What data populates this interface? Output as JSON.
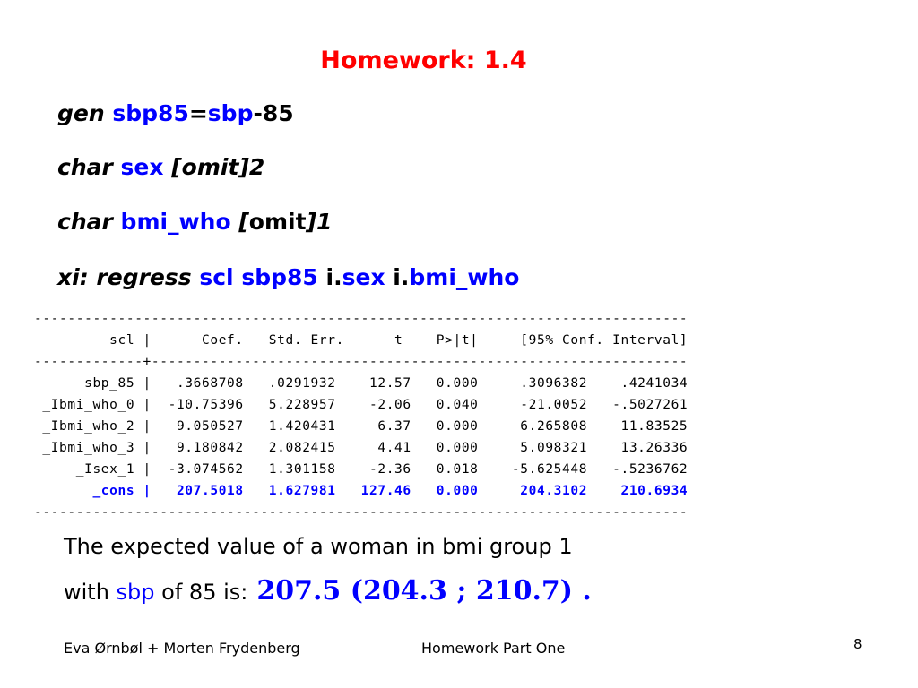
{
  "title": "Homework: 1.4",
  "commands": [
    {
      "kw": "gen",
      "var1": "sbp85",
      "eq": "=",
      "var2": "sbp",
      "rest": "-85"
    },
    {
      "kw": "char",
      "var": "sex",
      "rest": "[omit]2"
    },
    {
      "kw": "char",
      "var": "bmi_who",
      "open": "[",
      "mid": "omit",
      "close": "]1"
    },
    {
      "kw": "xi: regress",
      "v1": "scl",
      "v2": "sbp85",
      "p1": "i.",
      "v3": "sex",
      "p2": "i.",
      "v4": "bmi_who"
    }
  ],
  "output": {
    "rule_line": "------------------------------------------------------------------------------",
    "header_line": "         scl |      Coef.   Std. Err.      t    P>|t|     [95% Conf. Interval]",
    "separator_line": "-------------+----------------------------------------------------------------",
    "rows": [
      "      sbp_85 |   .3668708   .0291932    12.57   0.000     .3096382    .4241034",
      " _Ibmi_who_0 |  -10.75396   5.228957    -2.06   0.040     -21.0052   -.5027261",
      " _Ibmi_who_2 |   9.050527   1.420431     6.37   0.000     6.265808    11.83525",
      " _Ibmi_who_3 |   9.180842   2.082415     4.41   0.000     5.098321    13.26336",
      "     _Isex_1 |  -3.074562   1.301158    -2.36   0.018    -5.625448   -.5236762"
    ],
    "cons_row": "       _cons |   207.5018   1.627981   127.46   0.000     204.3102    210.6934",
    "bottom_rule": "------------------------------------------------------------------------------"
  },
  "explanation": {
    "line1": "The expected value of a woman in bmi group 1",
    "line2_a": "with ",
    "line2_var": "sbp",
    "line2_b": " of 85 is:",
    "result": "207.5 (204.3 ; 210.7) ."
  },
  "footer": {
    "author": "Eva Ørnbøl + Morten Frydenberg",
    "subject": "Homework Part One",
    "page": "8"
  },
  "colors": {
    "title": "#ff0000",
    "variable": "#0000ff",
    "text": "#000000"
  }
}
